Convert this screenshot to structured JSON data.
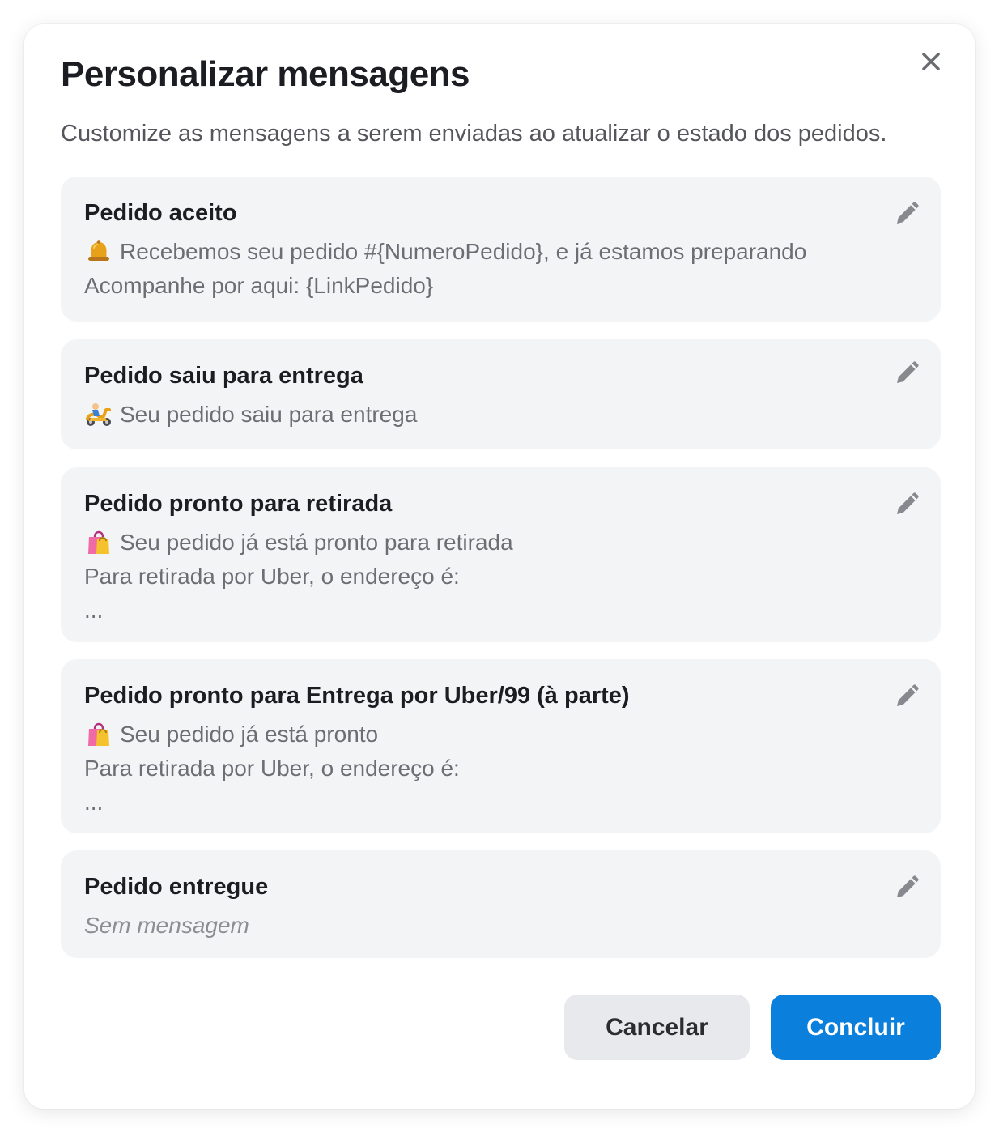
{
  "modal": {
    "title": "Personalizar mensagens",
    "subtitle": "Customize as mensagens a serem enviadas ao atualizar o estado dos pedidos.",
    "close_icon": "close-icon"
  },
  "cards": [
    {
      "title": "Pedido aceito",
      "lines": [
        {
          "emoji": "bell",
          "text": "Recebemos seu pedido #{NumeroPedido}, e já estamos preparando"
        },
        {
          "text": "Acompanhe por aqui: {LinkPedido}"
        }
      ]
    },
    {
      "title": "Pedido saiu para entrega",
      "lines": [
        {
          "emoji": "delivery-scooter",
          "text": "Seu pedido saiu para entrega"
        }
      ]
    },
    {
      "title": "Pedido pronto para retirada",
      "lines": [
        {
          "emoji": "shopping-bags",
          "text": "Seu pedido já está pronto para retirada"
        },
        {
          "text": "Para retirada por Uber, o endereço é:"
        },
        {
          "text": "..."
        }
      ]
    },
    {
      "title": "Pedido pronto para Entrega por Uber/99 (à parte)",
      "lines": [
        {
          "emoji": "shopping-bags",
          "text": "Seu pedido já está pronto"
        },
        {
          "text": "Para retirada por Uber, o endereço é:"
        },
        {
          "text": "..."
        }
      ]
    },
    {
      "title": "Pedido entregue",
      "lines": [
        {
          "text": "Sem mensagem",
          "style": "italic"
        }
      ]
    }
  ],
  "actions": {
    "cancel_label": "Cancelar",
    "confirm_label": "Concluir"
  },
  "colors": {
    "primary": "#0a7fdb",
    "card_background": "#f3f4f6",
    "secondary_button": "#e8e9ed",
    "title_text": "#1c1d22",
    "body_text": "#6d6e75"
  }
}
